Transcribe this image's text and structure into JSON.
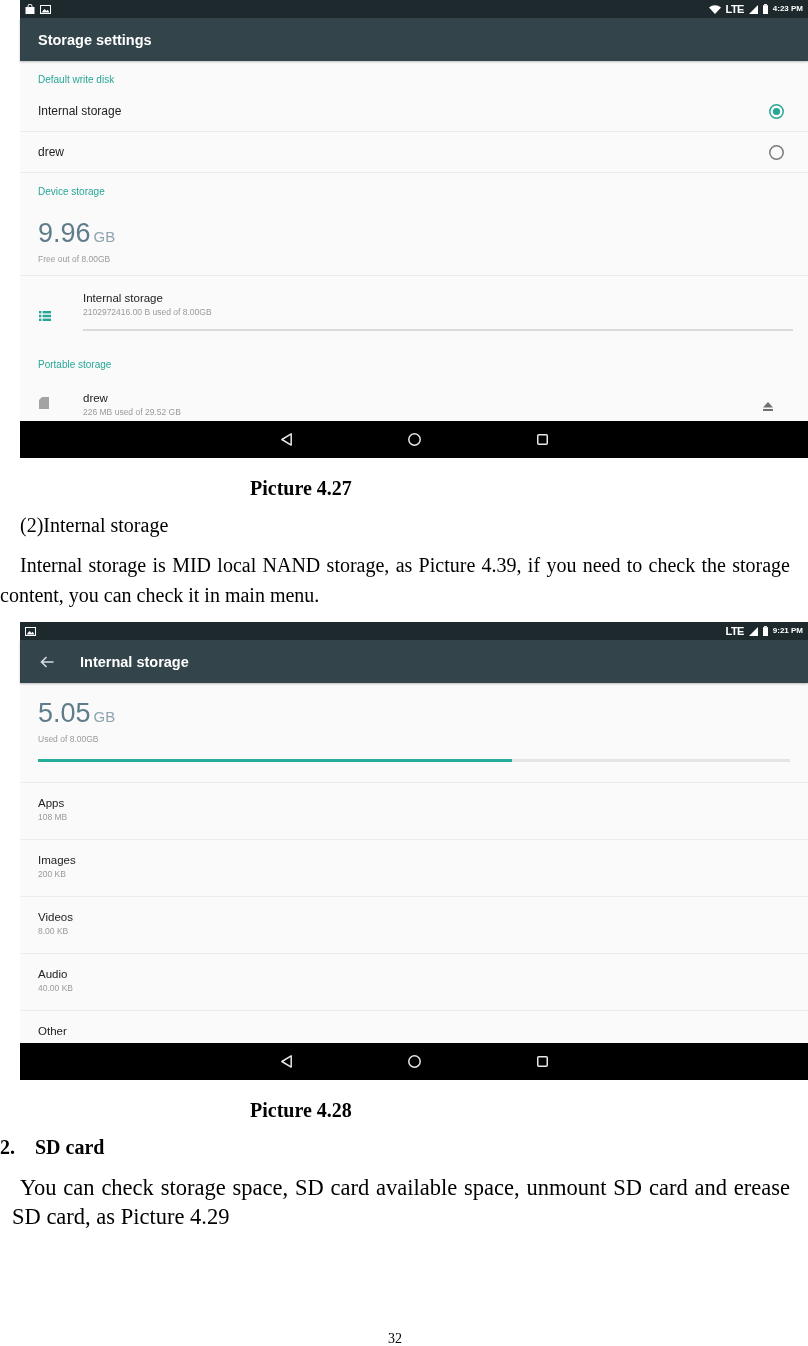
{
  "blocks": [
    {
      "kind": "screen",
      "status_bar": {
        "notifications": [
          {
            "kind": "bag"
          },
          {
            "kind": "image"
          }
        ],
        "wifi": true,
        "network": "LTE",
        "time": "4:23 PM"
      },
      "toolbar": {
        "title": "Storage settings",
        "back": false
      },
      "items": [
        {
          "kind": "subheader",
          "text": "Default write disk"
        },
        {
          "kind": "radio",
          "label": "Internal storage",
          "selected": true
        },
        {
          "kind": "radio",
          "label": "drew",
          "selected": false
        },
        {
          "kind": "subheader",
          "text": "Device storage"
        },
        {
          "kind": "summary",
          "value": "9.96",
          "unit": "GB",
          "caption": "Free out of 8.00GB"
        },
        {
          "kind": "internal",
          "title": "Internal storage",
          "detail": "2102972416.00 B used of 8.00GB"
        },
        {
          "kind": "subheader",
          "text": "Portable storage"
        },
        {
          "kind": "portable",
          "title": "drew",
          "detail": "226 MB used of 29.52 GB"
        }
      ]
    },
    {
      "kind": "caption",
      "text": "Picture 4.27"
    },
    {
      "kind": "heading",
      "text": "(2)Internal storage"
    },
    {
      "kind": "paragraph",
      "text": "Internal storage is MID local NAND storage, as Picture 4.39, if you need to check the storage content, you can check it in main menu."
    },
    {
      "kind": "screen",
      "status_bar": {
        "notifications": [
          {
            "kind": "image"
          }
        ],
        "wifi": false,
        "network": "LTE",
        "time": "9:21 PM"
      },
      "toolbar": {
        "title": "Internal storage",
        "back": true
      },
      "items": [
        {
          "kind": "summary",
          "value": "5.05",
          "unit": "GB",
          "caption": "Used of 8.00GB",
          "level": 0.63
        },
        {
          "kind": "category",
          "title": "Apps",
          "detail": "108 MB"
        },
        {
          "kind": "category",
          "title": "Images",
          "detail": "200 KB"
        },
        {
          "kind": "category",
          "title": "Videos",
          "detail": "8.00 KB"
        },
        {
          "kind": "category",
          "title": "Audio",
          "detail": "40.00 KB"
        },
        {
          "kind": "category",
          "title": "Other"
        }
      ]
    },
    {
      "kind": "caption",
      "text": "Picture 4.28"
    },
    {
      "kind": "numbered_heading",
      "number": "2.",
      "text": "SD card"
    },
    {
      "kind": "lead",
      "text": "You can check storage space, SD card available space, unmount SD card and erease SD card, as Picture 4.29"
    }
  ],
  "page_number": "32"
}
